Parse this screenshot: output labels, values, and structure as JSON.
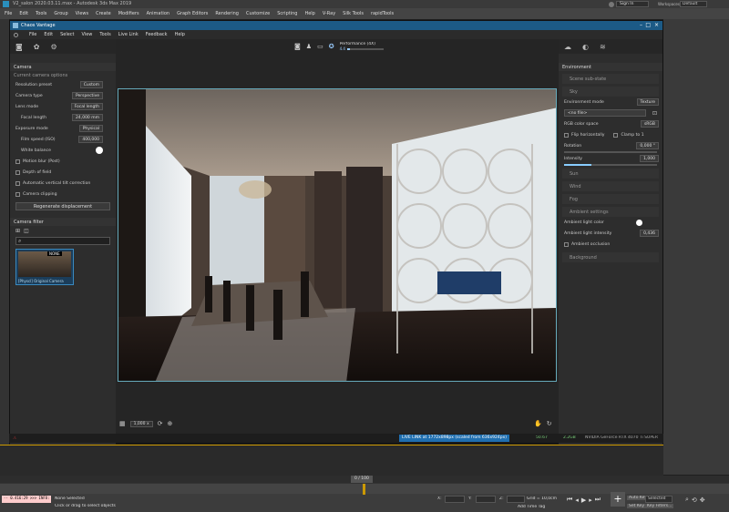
{
  "app_title": "V2_salon 2020.03.11.max - Autodesk 3ds Max 2019",
  "sign_in": "Sign In",
  "workspaces_label": "Workspaces:",
  "workspace_value": "Default",
  "main_menu": [
    "File",
    "Edit",
    "Tools",
    "Group",
    "Views",
    "Create",
    "Modifiers",
    "Animation",
    "Graph Editors",
    "Rendering",
    "Customize",
    "Scripting",
    "Help",
    "V-Ray",
    "Silk Tools",
    "rapidTools"
  ],
  "vantage": {
    "title": "Chaos Vantage",
    "menu": [
      "File",
      "Edit",
      "Select",
      "View",
      "Tools",
      "Live Link",
      "Feedback",
      "Help"
    ],
    "performance_label": "Performance (4X)",
    "fps": "4.4",
    "left_panel": {
      "title": "Camera",
      "current_options": "Current camera options",
      "props": [
        {
          "label": "Resolution preset",
          "value": "Custom"
        },
        {
          "label": "Camera type",
          "value": "Perspective"
        },
        {
          "label": "Lens mode",
          "value": "Focal length"
        },
        {
          "label": "Focal length",
          "value": "24,000 mm"
        },
        {
          "label": "Exposure mode",
          "value": "Physical"
        },
        {
          "label": "Film speed (ISO)",
          "value": "400,000"
        },
        {
          "label": "White balance",
          "value": ""
        }
      ],
      "checks": [
        "Motion blur (Post)",
        "Depth of field",
        "Automatic vertical tilt correction",
        "Camera clipping"
      ],
      "regen_button": "Regenerate displacement",
      "camera_filter": "Camera filter",
      "thumb_label": "NONE",
      "thumb_caption": "[Physcl] Original Camera"
    },
    "right_panel": {
      "title": "Environment",
      "scene_substate": "Scene sub-state",
      "sky": "Sky",
      "env_mode_label": "Environment mode",
      "env_mode_value": "Texture",
      "file": "<no file>",
      "rgb_label": "RGB color space",
      "rgb_value": "sRGB",
      "flip": "Flip horizontally",
      "clamp": "Clamp to 1",
      "rotation_label": "Rotation",
      "rotation_value": "0,000 °",
      "intensity_label": "Intensity",
      "intensity_value": "1,000",
      "sun": "Sun",
      "wind": "Wind",
      "fog": "Fog",
      "ambient": "Ambient settings",
      "ambient_color": "Ambient light color",
      "ambient_intensity_label": "Ambient light intensity",
      "ambient_intensity_value": "0,436",
      "ambient_occlusion": "Ambient occlusion",
      "background": "Background"
    },
    "zoom": "1,000 x",
    "status_live": "LIVE LINK at 1772x898px (scaled from 636x924px)",
    "status_fps": "50.67",
    "status_mem": "2.2GB",
    "status_gpu": "NVIDIA GeForce RTX 4070 Ti SUPER"
  },
  "timeline": {
    "frame": "0 / 100",
    "maxscript": "-- 0.416:29 >>> INFO:",
    "none_selected": "None Selected",
    "hint": "Click or drag to select objects",
    "x_label": "X:",
    "y_label": "Y:",
    "z_label": "Z:",
    "grid": "Grid = 10,0cm",
    "add_time_tag": "Add Time Tag",
    "auto_key": "Auto Key",
    "selected": "Selected",
    "set_key": "Set Key",
    "key_filters": "Key Filters..."
  }
}
